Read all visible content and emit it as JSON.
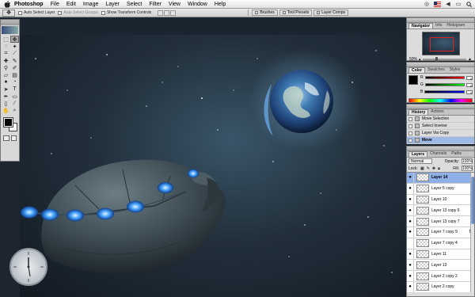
{
  "app": {
    "name": "Photoshop",
    "menus": [
      "File",
      "Edit",
      "Image",
      "Layer",
      "Select",
      "Filter",
      "View",
      "Window",
      "Help"
    ]
  },
  "status_icons": [
    "help-icon",
    "flag-icon",
    "volume-icon",
    "battery-icon",
    "spotlight-icon"
  ],
  "options": {
    "auto_select_layer": "Auto Select Layer",
    "auto_select_groups": "Auto Select Groups",
    "show_transform_controls": "Show Transform Controls",
    "well_tabs": [
      "Brushes",
      "Tool Presets",
      "Layer Comps"
    ]
  },
  "navigator": {
    "tabs": [
      "Navigator",
      "Info",
      "Histogram"
    ],
    "zoom": "50%"
  },
  "color_panel": {
    "tabs": [
      "Color",
      "Swatches",
      "Styles"
    ],
    "channels": [
      {
        "label": "R",
        "value": "0",
        "gradient": "linear-gradient(90deg,#000,#f00)"
      },
      {
        "label": "G",
        "value": "0",
        "gradient": "linear-gradient(90deg,#000,#0f0)"
      },
      {
        "label": "B",
        "value": "0",
        "gradient": "linear-gradient(90deg,#000,#00f)"
      }
    ]
  },
  "history": {
    "tabs": [
      "History",
      "Actions"
    ],
    "items": [
      {
        "label": "Move Selection",
        "selected": false
      },
      {
        "label": "Select Inverse",
        "selected": false
      },
      {
        "label": "Layer Via Copy",
        "selected": false
      },
      {
        "label": "Move",
        "selected": true
      }
    ]
  },
  "layers": {
    "tabs": [
      "Layers",
      "Channels",
      "Paths"
    ],
    "blend_mode": "Normal",
    "opacity_label": "Opacity:",
    "opacity": "100%",
    "lock_label": "Lock:",
    "fill_label": "Fill:",
    "fill": "100%",
    "items": [
      {
        "name": "Layer 14",
        "visible": true,
        "selected": true,
        "fx": ""
      },
      {
        "name": "Layer 5 copy",
        "visible": true,
        "selected": false,
        "fx": ""
      },
      {
        "name": "Layer 10",
        "visible": true,
        "selected": false,
        "fx": ""
      },
      {
        "name": "Layer 13 copy 6",
        "visible": true,
        "selected": false,
        "fx": ""
      },
      {
        "name": "Layer 13 copy 7",
        "visible": true,
        "selected": false,
        "fx": ""
      },
      {
        "name": "Layer 7 copy 9",
        "visible": true,
        "selected": false,
        "fx": "fx"
      },
      {
        "name": "Layer 7 copy 4",
        "visible": false,
        "selected": false,
        "fx": ""
      },
      {
        "name": "Layer 11",
        "visible": true,
        "selected": false,
        "fx": ""
      },
      {
        "name": "Layer 13",
        "visible": true,
        "selected": false,
        "fx": ""
      },
      {
        "name": "Layer 2 copy 2",
        "visible": true,
        "selected": false,
        "fx": ""
      },
      {
        "name": "Layer 2 copy",
        "visible": true,
        "selected": false,
        "fx": ""
      }
    ]
  },
  "colors": {
    "selection": "#8fb0e6",
    "canvas_bg": "#22303c"
  }
}
